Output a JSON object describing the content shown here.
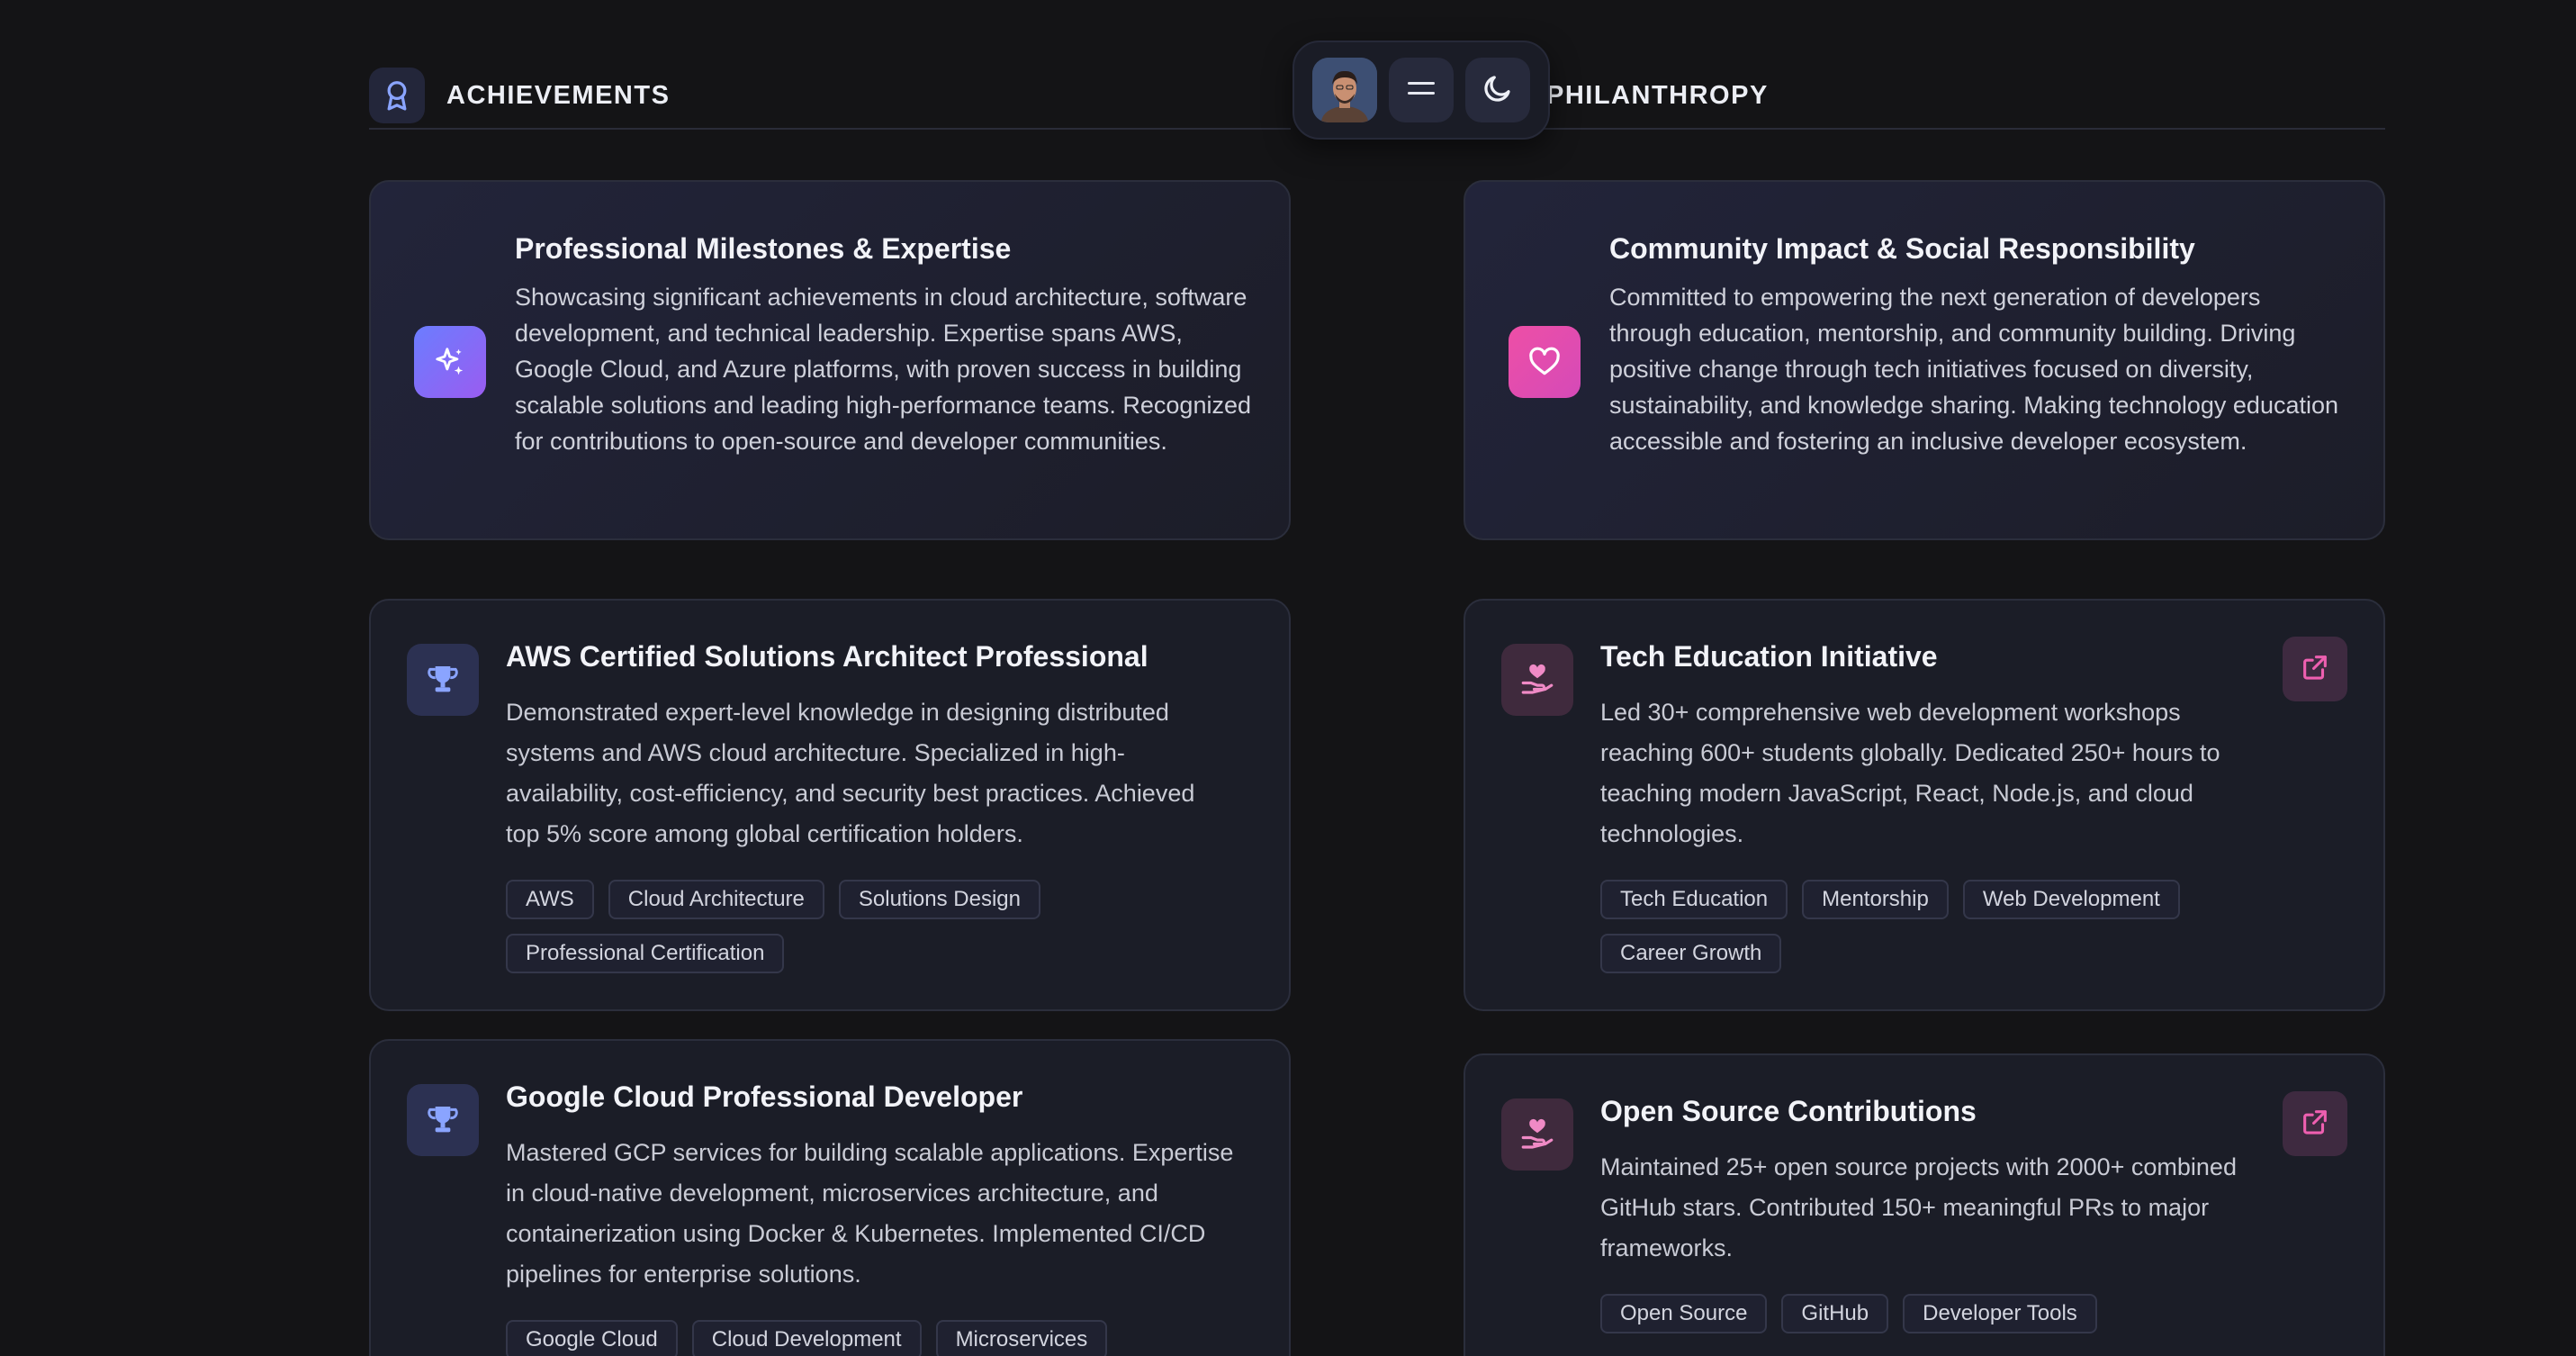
{
  "achievements": {
    "header": {
      "title": "ACHIEVEMENTS",
      "icon": "award-icon"
    },
    "hero": {
      "title": "Professional Milestones & Expertise",
      "description": "Showcasing significant achievements in cloud architecture, software development, and technical leadership. Expertise spans AWS, Google Cloud, and Azure platforms, with proven success in building scalable solutions and leading high-performance teams. Recognized for contributions to open-source and developer communities.",
      "icon": "sparkles-icon"
    },
    "items": [
      {
        "title": "AWS Certified Solutions Architect Professional",
        "description": "Demonstrated expert-level knowledge in designing distributed systems and AWS cloud architecture. Specialized in high-availability, cost-efficiency, and security best practices. Achieved top 5% score among global certification holders.",
        "icon": "trophy-icon",
        "tags": [
          "AWS",
          "Cloud Architecture",
          "Solutions Design",
          "Professional Certification"
        ]
      },
      {
        "title": "Google Cloud Professional Developer",
        "description": "Mastered GCP services for building scalable applications. Expertise in cloud-native development, microservices architecture, and containerization using Docker & Kubernetes. Implemented CI/CD pipelines for enterprise solutions.",
        "icon": "trophy-icon",
        "tags": [
          "Google Cloud",
          "Cloud Development",
          "Microservices"
        ]
      }
    ]
  },
  "philanthropy": {
    "header": {
      "title": "PHILANTHROPY"
    },
    "hero": {
      "title": "Community Impact & Social Responsibility",
      "description": "Committed to empowering the next generation of developers through education, mentorship, and community building. Driving positive change through tech initiatives focused on diversity, sustainability, and knowledge sharing. Making technology education accessible and fostering an inclusive developer ecosystem.",
      "icon": "heart-icon"
    },
    "items": [
      {
        "title": "Tech Education Initiative",
        "description": "Led 30+ comprehensive web development workshops reaching 600+ students globally. Dedicated 250+ hours to teaching modern JavaScript, React, Node.js, and cloud technologies.",
        "icon": "hand-heart-icon",
        "tags": [
          "Tech Education",
          "Mentorship",
          "Web Development",
          "Career Growth"
        ]
      },
      {
        "title": "Open Source Contributions",
        "description": "Maintained 25+ open source projects with 2000+ combined GitHub stars. Contributed 150+ meaningful PRs to major frameworks.",
        "icon": "hand-heart-icon",
        "tags": [
          "Open Source",
          "GitHub",
          "Developer Tools"
        ]
      }
    ]
  },
  "navbar": {
    "avatar": "avatar",
    "menu_icon": "menu-icon",
    "theme_icon": "moon-icon"
  },
  "colors": {
    "background": "#141416",
    "card": "#1b1d27",
    "accent_violet": "#7a6cff",
    "accent_pink": "#ee4fa6",
    "trophy_blue": "#7f9cf5"
  }
}
